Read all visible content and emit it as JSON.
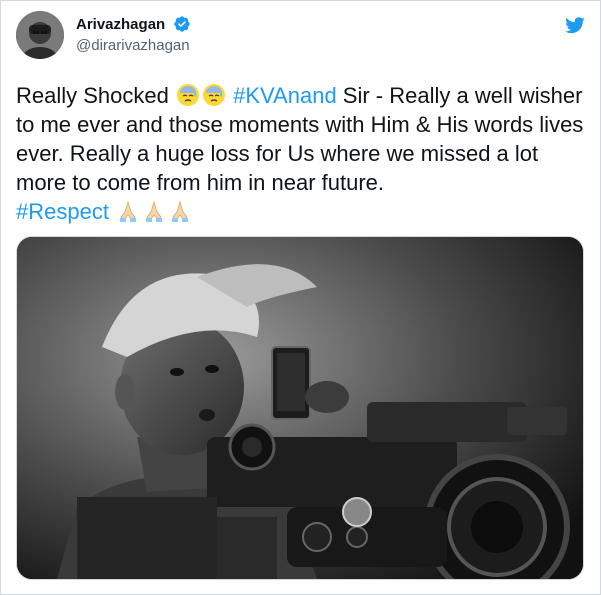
{
  "author": {
    "display_name": "Arivazhagan",
    "handle": "@dirarivazhagan",
    "verified": true
  },
  "icons": {
    "avatar": "avatar-photo",
    "verified": "verified-badge-icon",
    "logo": "twitter-bird-icon",
    "sad_emoji": "downcast-face-with-sweat-emoji",
    "pray_emoji": "folded-hands-emoji"
  },
  "tweet": {
    "segment_1": "Really Shocked ",
    "hashtag_1": "#KVAnand",
    "segment_2": " Sir - Really a well wisher to me ever and those moments with Him & His words lives ever. Really a huge loss for Us where we missed a lot more to come from him in near future.",
    "hashtag_2": "#Respect"
  },
  "media": {
    "kind": "photo",
    "description_icon": "photo-director-with-camera"
  },
  "colors": {
    "link": "#1d9bf0",
    "text": "#0f1419",
    "secondary": "#536471",
    "border": "#cfd9de"
  }
}
